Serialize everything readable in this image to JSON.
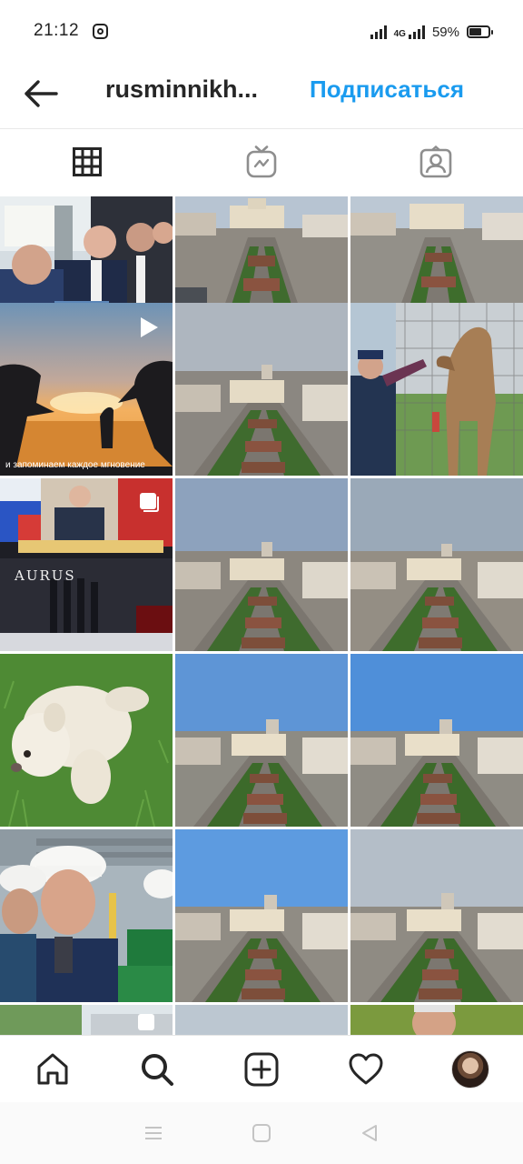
{
  "status_bar": {
    "time": "21:12",
    "network": "4G",
    "battery": "59%"
  },
  "header": {
    "username": "rusminnikh...",
    "follow_label": "Подписаться"
  },
  "tabs": [
    {
      "icon": "grid-icon",
      "active": true
    },
    {
      "icon": "igtv-icon",
      "active": false
    },
    {
      "icon": "tagged-icon",
      "active": false
    }
  ],
  "grid": {
    "tiles": [
      {
        "kind": "people"
      },
      {
        "kind": "square"
      },
      {
        "kind": "square"
      },
      {
        "kind": "sunset",
        "caption": "и запоминаем каждое мгновение",
        "video": true
      },
      {
        "kind": "square"
      },
      {
        "kind": "horse"
      },
      {
        "kind": "aurus",
        "aurus_text": "AURUS",
        "carousel": true
      },
      {
        "kind": "square"
      },
      {
        "kind": "square"
      },
      {
        "kind": "puppy"
      },
      {
        "kind": "square"
      },
      {
        "kind": "square"
      },
      {
        "kind": "helmets"
      },
      {
        "kind": "square"
      },
      {
        "kind": "square"
      },
      {
        "kind": "partial"
      },
      {
        "kind": "partial"
      },
      {
        "kind": "partial"
      }
    ]
  },
  "bottom_nav": [
    "home-icon",
    "search-icon",
    "create-icon",
    "activity-icon",
    "profile-avatar"
  ],
  "colors": {
    "accent": "#1a9bef",
    "text": "#262626"
  }
}
